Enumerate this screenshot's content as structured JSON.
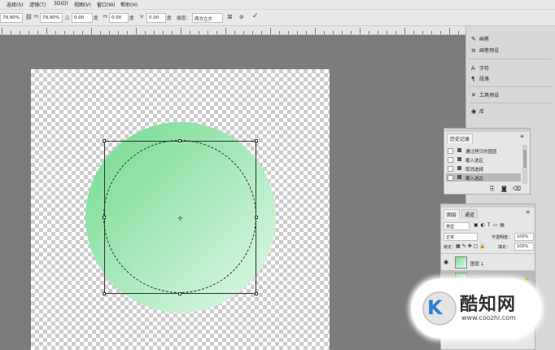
{
  "menu": [
    "选择(S)",
    "滤镜(T)",
    "3D(D)",
    "视图(V)",
    "窗口(W)",
    "帮助(H)"
  ],
  "options": {
    "w_value": "79.90%",
    "h_label": "H:",
    "h_value": "79.90%",
    "angle_value": "0.00",
    "hskew_label": "H:",
    "hskew_value": "0.00",
    "vskew_label": "V:",
    "vskew_value": "0.00",
    "interp_label": "插值：",
    "interp_value": "两次立方",
    "confirm_symbol": "✓",
    "cancel_symbol": "⊘"
  },
  "right_panel": {
    "items": [
      {
        "icon": "brush-icon",
        "glyph": "✎",
        "label": "画笔"
      },
      {
        "icon": "brush-presets-icon",
        "glyph": "≡",
        "label": "画笔预设"
      },
      {
        "icon": "character-icon",
        "glyph": "A",
        "label": "字符"
      },
      {
        "icon": "paragraph-icon",
        "glyph": "¶",
        "label": "段落"
      },
      {
        "icon": "tool-presets-icon",
        "glyph": "✕",
        "label": "工具预设"
      },
      {
        "icon": "library-icon",
        "glyph": "◉",
        "label": "库"
      }
    ]
  },
  "history": {
    "tab": "历史记录",
    "rows": [
      {
        "label": "通过拷贝的图层"
      },
      {
        "label": "载入选区"
      },
      {
        "label": "取消选择"
      },
      {
        "label": "载入选区"
      }
    ]
  },
  "layers": {
    "tab_layers": "图层",
    "tab_channels": "通道",
    "kind": "类型",
    "blend_mode": "正常",
    "opacity_label": "不透明度：",
    "opacity_value": "100%",
    "lock_label": "锁定：",
    "fill_label": "填充：",
    "fill_value": "100%",
    "rows": [
      {
        "name": "图层 1"
      },
      {
        "name": "背景"
      }
    ]
  },
  "watermark": {
    "name": "酷知网",
    "url": "www.coozhi.com",
    "logo_letter": "K"
  },
  "colors": {
    "circle_start": "#6fd98c",
    "circle_end": "#e2f8e8",
    "workspace": "#7c7c7c",
    "selected_row": "#b9b9b9"
  }
}
